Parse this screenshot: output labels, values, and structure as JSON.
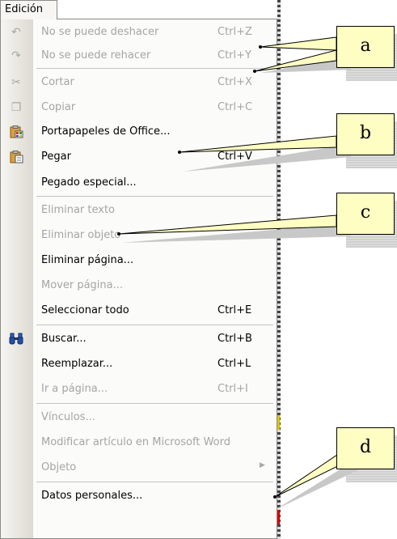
{
  "menubar": {
    "title": "Edición"
  },
  "menu": {
    "items": [
      {
        "label": "No se puede deshacer",
        "shortcut": "Ctrl+Z",
        "icon": "undo-icon",
        "disabled": true
      },
      {
        "label": "No se puede rehacer",
        "shortcut": "Ctrl+Y",
        "icon": "redo-icon",
        "disabled": true
      },
      {
        "label": "Cortar",
        "shortcut": "Ctrl+X",
        "icon": "scissors-icon",
        "disabled": true
      },
      {
        "label": "Copiar",
        "shortcut": "Ctrl+C",
        "icon": "copy-icon",
        "disabled": true
      },
      {
        "label": "Portapapeles de Office...",
        "shortcut": "",
        "icon": "office-clipboard-icon",
        "disabled": false
      },
      {
        "label": "Pegar",
        "shortcut": "Ctrl+V",
        "icon": "paste-icon",
        "disabled": false
      },
      {
        "label": "Pegado especial...",
        "shortcut": "",
        "icon": "",
        "disabled": false
      },
      {
        "label": "Eliminar texto",
        "shortcut": "",
        "icon": "",
        "disabled": true
      },
      {
        "label": "Eliminar objeto",
        "shortcut": "",
        "icon": "",
        "disabled": true
      },
      {
        "label": "Eliminar página...",
        "shortcut": "",
        "icon": "",
        "disabled": false
      },
      {
        "label": "Mover página...",
        "shortcut": "",
        "icon": "",
        "disabled": true
      },
      {
        "label": "Seleccionar todo",
        "shortcut": "Ctrl+E",
        "icon": "",
        "disabled": false
      },
      {
        "label": "Buscar...",
        "shortcut": "Ctrl+B",
        "icon": "binoculars-icon",
        "disabled": false
      },
      {
        "label": "Reemplazar...",
        "shortcut": "Ctrl+L",
        "icon": "",
        "disabled": false
      },
      {
        "label": "Ir a página...",
        "shortcut": "Ctrl+I",
        "icon": "",
        "disabled": true
      },
      {
        "label": "Vínculos...",
        "shortcut": "",
        "icon": "",
        "disabled": true
      },
      {
        "label": "Modificar artículo en Microsoft Word",
        "shortcut": "",
        "icon": "",
        "disabled": true
      },
      {
        "label": "Objeto",
        "shortcut": "",
        "icon": "submenu-arrow-icon",
        "disabled": true
      },
      {
        "label": "Datos personales...",
        "shortcut": "",
        "icon": "",
        "disabled": false
      }
    ]
  },
  "callouts": {
    "a": "a",
    "b": "b",
    "c": "c",
    "d": "d"
  },
  "colors": {
    "disabled_text": "#a5a5a5",
    "callout_fill": "#fefec2",
    "icon_strip": "#e6e4dd"
  }
}
